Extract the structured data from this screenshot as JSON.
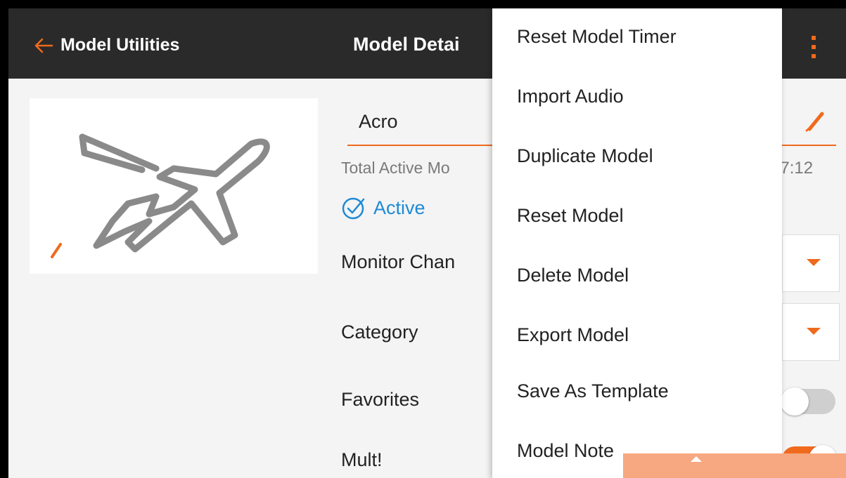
{
  "topbar": {
    "back_label": "Model Utilities",
    "title": "Model Detai",
    "menu_icon": "kebab-menu-icon"
  },
  "colors": {
    "accent": "#f06a1d",
    "active_blue": "#1e8ad6",
    "topbar_bg": "#2a2a2a",
    "content_bg": "#f4f4f4"
  },
  "model": {
    "name": "Acro",
    "total_active_label": "Total Active Mo",
    "total_active_value": "07:12",
    "status": "Active",
    "image_icon": "airplane-icon"
  },
  "settings": {
    "monitor_label": "Monitor Chan",
    "category_label": "Category",
    "favorites_label": "Favorites",
    "favorites_on": false,
    "next_label": "Mult!",
    "next_toggle_on": true
  },
  "menu": {
    "items": [
      "Reset Model Timer",
      "Import Audio",
      "Duplicate Model",
      "Reset Model",
      "Delete Model",
      "Export Model",
      "Save As Template",
      "Model Note"
    ]
  }
}
